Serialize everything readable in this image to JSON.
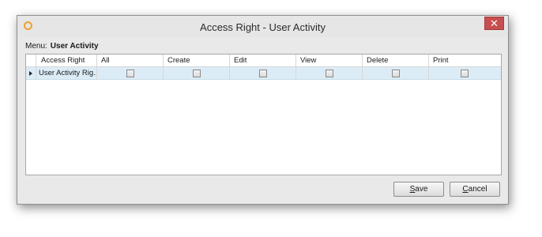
{
  "window": {
    "title": "Access Right - User Activity",
    "close_glyph": "✕"
  },
  "menu": {
    "label": "Menu:",
    "value": "User Activity"
  },
  "grid": {
    "columns": [
      "Access Right",
      "All",
      "Create",
      "Edit",
      "View",
      "Delete",
      "Print"
    ],
    "rows": [
      {
        "access_right": "User Activity Rig…",
        "all": false,
        "create": false,
        "edit": false,
        "view": false,
        "delete": false,
        "print": false
      }
    ]
  },
  "buttons": {
    "save_mnemonic": "S",
    "save_rest": "ave",
    "cancel_mnemonic": "C",
    "cancel_rest": "ancel"
  },
  "colors": {
    "close_button": "#c74f4f",
    "selected_row": "#dcecf7",
    "app_icon": "#f0a030"
  },
  "icons": {
    "app": "app-logo-icon",
    "close": "close-icon",
    "row_indicator": "row-pointer-icon"
  }
}
